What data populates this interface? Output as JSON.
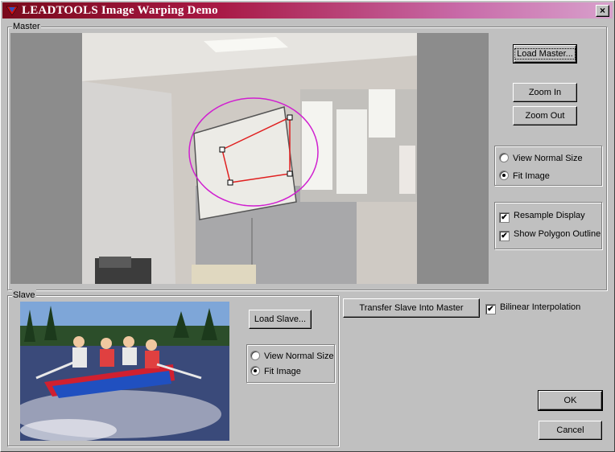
{
  "window": {
    "title": "LEADTOOLS Image Warping Demo",
    "close_label": "×"
  },
  "master": {
    "group_label": "Master",
    "load_button": "Load Master...",
    "zoom_in_button": "Zoom In",
    "zoom_out_button": "Zoom Out",
    "view_options": [
      {
        "label": "View Normal Size",
        "selected": false
      },
      {
        "label": "Fit Image",
        "selected": true
      }
    ],
    "display_options": [
      {
        "label": "Resample Display",
        "checked": true
      },
      {
        "label": "Show Polygon Outline",
        "checked": true
      }
    ]
  },
  "slave": {
    "group_label": "Slave",
    "load_button": "Load Slave...",
    "view_options": [
      {
        "label": "View Normal Size",
        "selected": false
      },
      {
        "label": "Fit Image",
        "selected": true
      }
    ]
  },
  "transfer_button": "Transfer Slave Into Master",
  "bilinear": {
    "label": "Bilinear Interpolation",
    "checked": true
  },
  "ok_button": "OK",
  "cancel_button": "Cancel",
  "check_mark": "✔",
  "colors": {
    "ellipse": "#d020d0",
    "polygon": "#e02020",
    "title_start": "#7a0a1c",
    "title_end": "#d8a0cc"
  }
}
